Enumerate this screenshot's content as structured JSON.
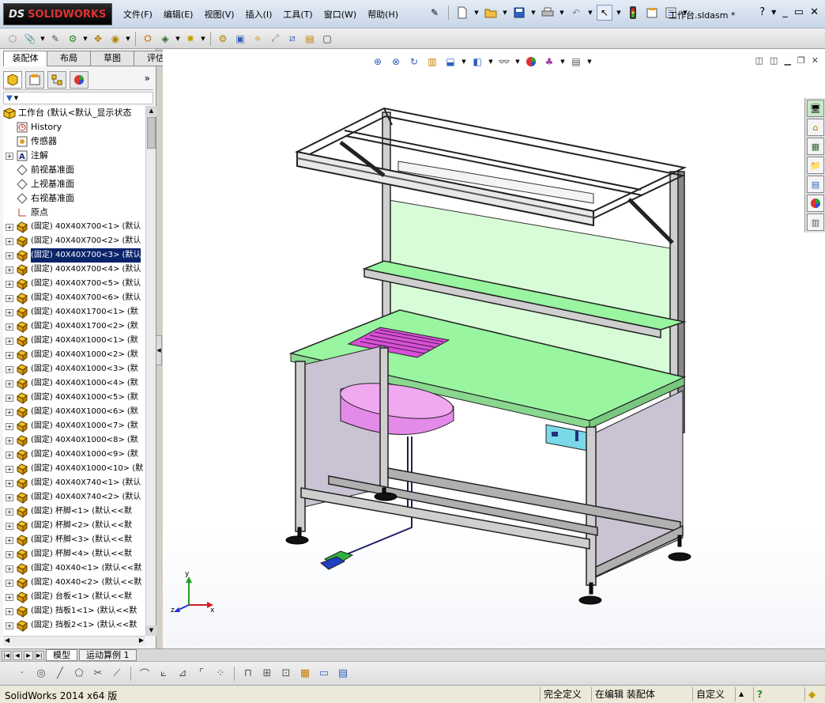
{
  "app": {
    "logo_ds": "DS",
    "logo_text": "SOLIDWORKS",
    "document_title": "工作台.sldasm *",
    "help_label": "?"
  },
  "menu": [
    "文件(F)",
    "编辑(E)",
    "视图(V)",
    "插入(I)",
    "工具(T)",
    "窗口(W)",
    "帮助(H)"
  ],
  "command_manager_tabs": [
    {
      "label": "装配体",
      "active": true
    },
    {
      "label": "布局",
      "active": false
    },
    {
      "label": "草图",
      "active": false
    },
    {
      "label": "评估",
      "active": false
    }
  ],
  "feature_manager": {
    "more_label": "»",
    "root": "工作台  (默认<默认_显示状态",
    "items": [
      {
        "label": "History",
        "icon": "history-icon",
        "expandable": false
      },
      {
        "label": "传感器",
        "icon": "sensor-icon",
        "expandable": false
      },
      {
        "label": "注解",
        "icon": "annotation-icon",
        "expandable": true
      },
      {
        "label": "前视基准面",
        "icon": "plane-icon",
        "expandable": false
      },
      {
        "label": "上视基准面",
        "icon": "plane-icon",
        "expandable": false
      },
      {
        "label": "右视基准面",
        "icon": "plane-icon",
        "expandable": false
      },
      {
        "label": "原点",
        "icon": "origin-icon",
        "expandable": false
      },
      {
        "label": "(固定) 40X40X700<1> (默认",
        "icon": "part-icon",
        "expandable": true
      },
      {
        "label": "(固定) 40X40X700<2> (默认",
        "icon": "part-icon",
        "expandable": true
      },
      {
        "label": "(固定) 40X40X700<3> (默认",
        "icon": "part-icon",
        "expandable": true,
        "selected": true
      },
      {
        "label": "(固定) 40X40X700<4> (默认",
        "icon": "part-icon",
        "expandable": true
      },
      {
        "label": "(固定) 40X40X700<5> (默认",
        "icon": "part-icon",
        "expandable": true
      },
      {
        "label": "(固定) 40X40X700<6> (默认",
        "icon": "part-icon",
        "expandable": true
      },
      {
        "label": "(固定) 40X40X1700<1> (默",
        "icon": "part-icon",
        "expandable": true
      },
      {
        "label": "(固定) 40X40X1700<2> (默",
        "icon": "part-icon",
        "expandable": true
      },
      {
        "label": "(固定) 40X40X1000<1> (默",
        "icon": "part-icon",
        "expandable": true
      },
      {
        "label": "(固定) 40X40X1000<2> (默",
        "icon": "part-icon",
        "expandable": true
      },
      {
        "label": "(固定) 40X40X1000<3> (默",
        "icon": "part-icon",
        "expandable": true
      },
      {
        "label": "(固定) 40X40X1000<4> (默",
        "icon": "part-icon",
        "expandable": true
      },
      {
        "label": "(固定) 40X40X1000<5> (默",
        "icon": "part-icon",
        "expandable": true
      },
      {
        "label": "(固定) 40X40X1000<6> (默",
        "icon": "part-icon",
        "expandable": true
      },
      {
        "label": "(固定) 40X40X1000<7> (默",
        "icon": "part-icon",
        "expandable": true
      },
      {
        "label": "(固定) 40X40X1000<8> (默",
        "icon": "part-icon",
        "expandable": true
      },
      {
        "label": "(固定) 40X40X1000<9> (默",
        "icon": "part-icon",
        "expandable": true
      },
      {
        "label": "(固定) 40X40X1000<10> (默",
        "icon": "part-icon",
        "expandable": true
      },
      {
        "label": "(固定) 40X40X740<1> (默认",
        "icon": "part-icon",
        "expandable": true
      },
      {
        "label": "(固定) 40X40X740<2> (默认",
        "icon": "part-icon",
        "expandable": true
      },
      {
        "label": "(固定) 杯脚<1> (默认<<默",
        "icon": "part-icon",
        "expandable": true
      },
      {
        "label": "(固定) 杯脚<2> (默认<<默",
        "icon": "part-icon",
        "expandable": true
      },
      {
        "label": "(固定) 杯脚<3> (默认<<默",
        "icon": "part-icon",
        "expandable": true
      },
      {
        "label": "(固定) 杯脚<4> (默认<<默",
        "icon": "part-icon",
        "expandable": true
      },
      {
        "label": "(固定) 40X40<1> (默认<<默",
        "icon": "part-icon",
        "expandable": true
      },
      {
        "label": "(固定) 40X40<2> (默认<<默",
        "icon": "part-icon",
        "expandable": true
      },
      {
        "label": "(固定) 台板<1> (默认<<默",
        "icon": "part-icon",
        "expandable": true
      },
      {
        "label": "(固定) 挡板1<1> (默认<<默",
        "icon": "part-icon",
        "expandable": true
      },
      {
        "label": "(固定) 挡板2<1> (默认<<默",
        "icon": "part-icon",
        "expandable": true
      }
    ]
  },
  "bottom_tabs": [
    {
      "label": "模型",
      "active": true
    },
    {
      "label": "运动算例 1",
      "active": false
    }
  ],
  "status": {
    "product": "SolidWorks 2014 x64 版",
    "fully_defined": "完全定义",
    "editing": "在编辑 装配体",
    "units": "自定义",
    "help": "?"
  },
  "triad": {
    "x": "x",
    "y": "y",
    "z": "z"
  },
  "colors": {
    "accent_blue": "#0a246a",
    "frame": "#2a2a2a",
    "tabletop": "#99f5a0",
    "backpanel": "#d8fcd8",
    "sidepanel": "#c9c3d4",
    "bin": "#e48ae8"
  }
}
